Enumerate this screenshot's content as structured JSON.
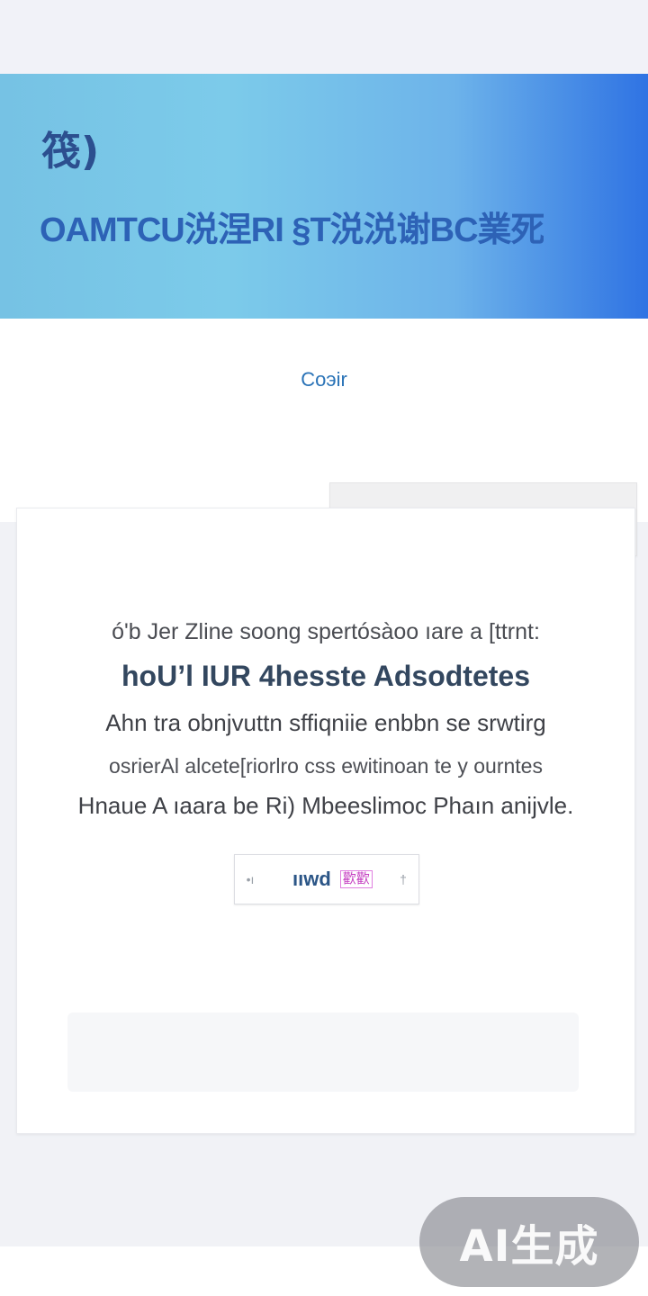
{
  "banner": {
    "glyph": "筏)",
    "headline": "OAMTCU涚涅RI §T涚涚谢BC業死"
  },
  "center_link": "Coэir",
  "card": {
    "overline": "ó'b Jer Zline soong  spertósàoo ıare a [ttrnt:",
    "title": "hoU’l IUR 4hesste Adsodtetes",
    "body_lines": [
      "Ahn tra obnjvuttn sffiqniie enbbn se srwtirg",
      "osrierAl alcete[riorlro css ewitinoan te y ourntes",
      "Hnaue A ıaara be Ri) Mbeeslimoc Phaın anijvle."
    ],
    "button": {
      "left_mark": "•ı",
      "label": "ııwd",
      "badge": "歡歡",
      "right_mark": "†"
    }
  },
  "watermark": "AI生成"
}
